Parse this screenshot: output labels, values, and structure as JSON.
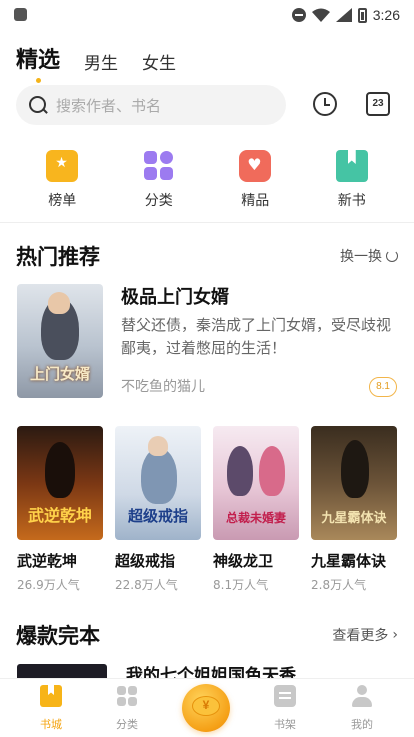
{
  "status_bar": {
    "time": "3:26"
  },
  "top_tabs": [
    {
      "label": "精选",
      "active": true
    },
    {
      "label": "男生",
      "active": false
    },
    {
      "label": "女生",
      "active": false
    }
  ],
  "search": {
    "placeholder": "搜索作者、书名"
  },
  "calendar_day": "23",
  "categories": [
    {
      "label": "榜单",
      "icon": "ranking-icon"
    },
    {
      "label": "分类",
      "icon": "category-icon"
    },
    {
      "label": "精品",
      "icon": "premium-icon"
    },
    {
      "label": "新书",
      "icon": "new-book-icon"
    }
  ],
  "hot": {
    "title": "热门推荐",
    "action": "换一换",
    "featured": {
      "title": "极品上门女婿",
      "description": "替父还债，秦浩成了上门女婿，受尽歧视鄙夷，过着憋屈的生活！",
      "author": "不吃鱼的猫儿",
      "score": "8.1",
      "cover_text": "上门女婿"
    },
    "books": [
      {
        "title": "武逆乾坤",
        "popularity": "26.9万人气",
        "cover_text": "武逆乾坤"
      },
      {
        "title": "超级戒指",
        "popularity": "22.8万人气",
        "cover_text": "超级戒指"
      },
      {
        "title": "神级龙卫",
        "popularity": "8.1万人气",
        "cover_text": "总裁未婚妻"
      },
      {
        "title": "九星霸体诀",
        "popularity": "2.8万人气",
        "cover_text": "九星霸体诀"
      }
    ]
  },
  "finished": {
    "title": "爆款完本",
    "action": "查看更多",
    "first_book_title": "我的七个姐姐国色天香"
  },
  "bottom_nav": [
    {
      "label": "书城",
      "active": true
    },
    {
      "label": "分类",
      "active": false
    },
    {
      "label": "书架",
      "active": false
    },
    {
      "label": "我的",
      "active": false
    }
  ],
  "colors": {
    "accent": "#f4b319",
    "score": "#e39c1e"
  }
}
